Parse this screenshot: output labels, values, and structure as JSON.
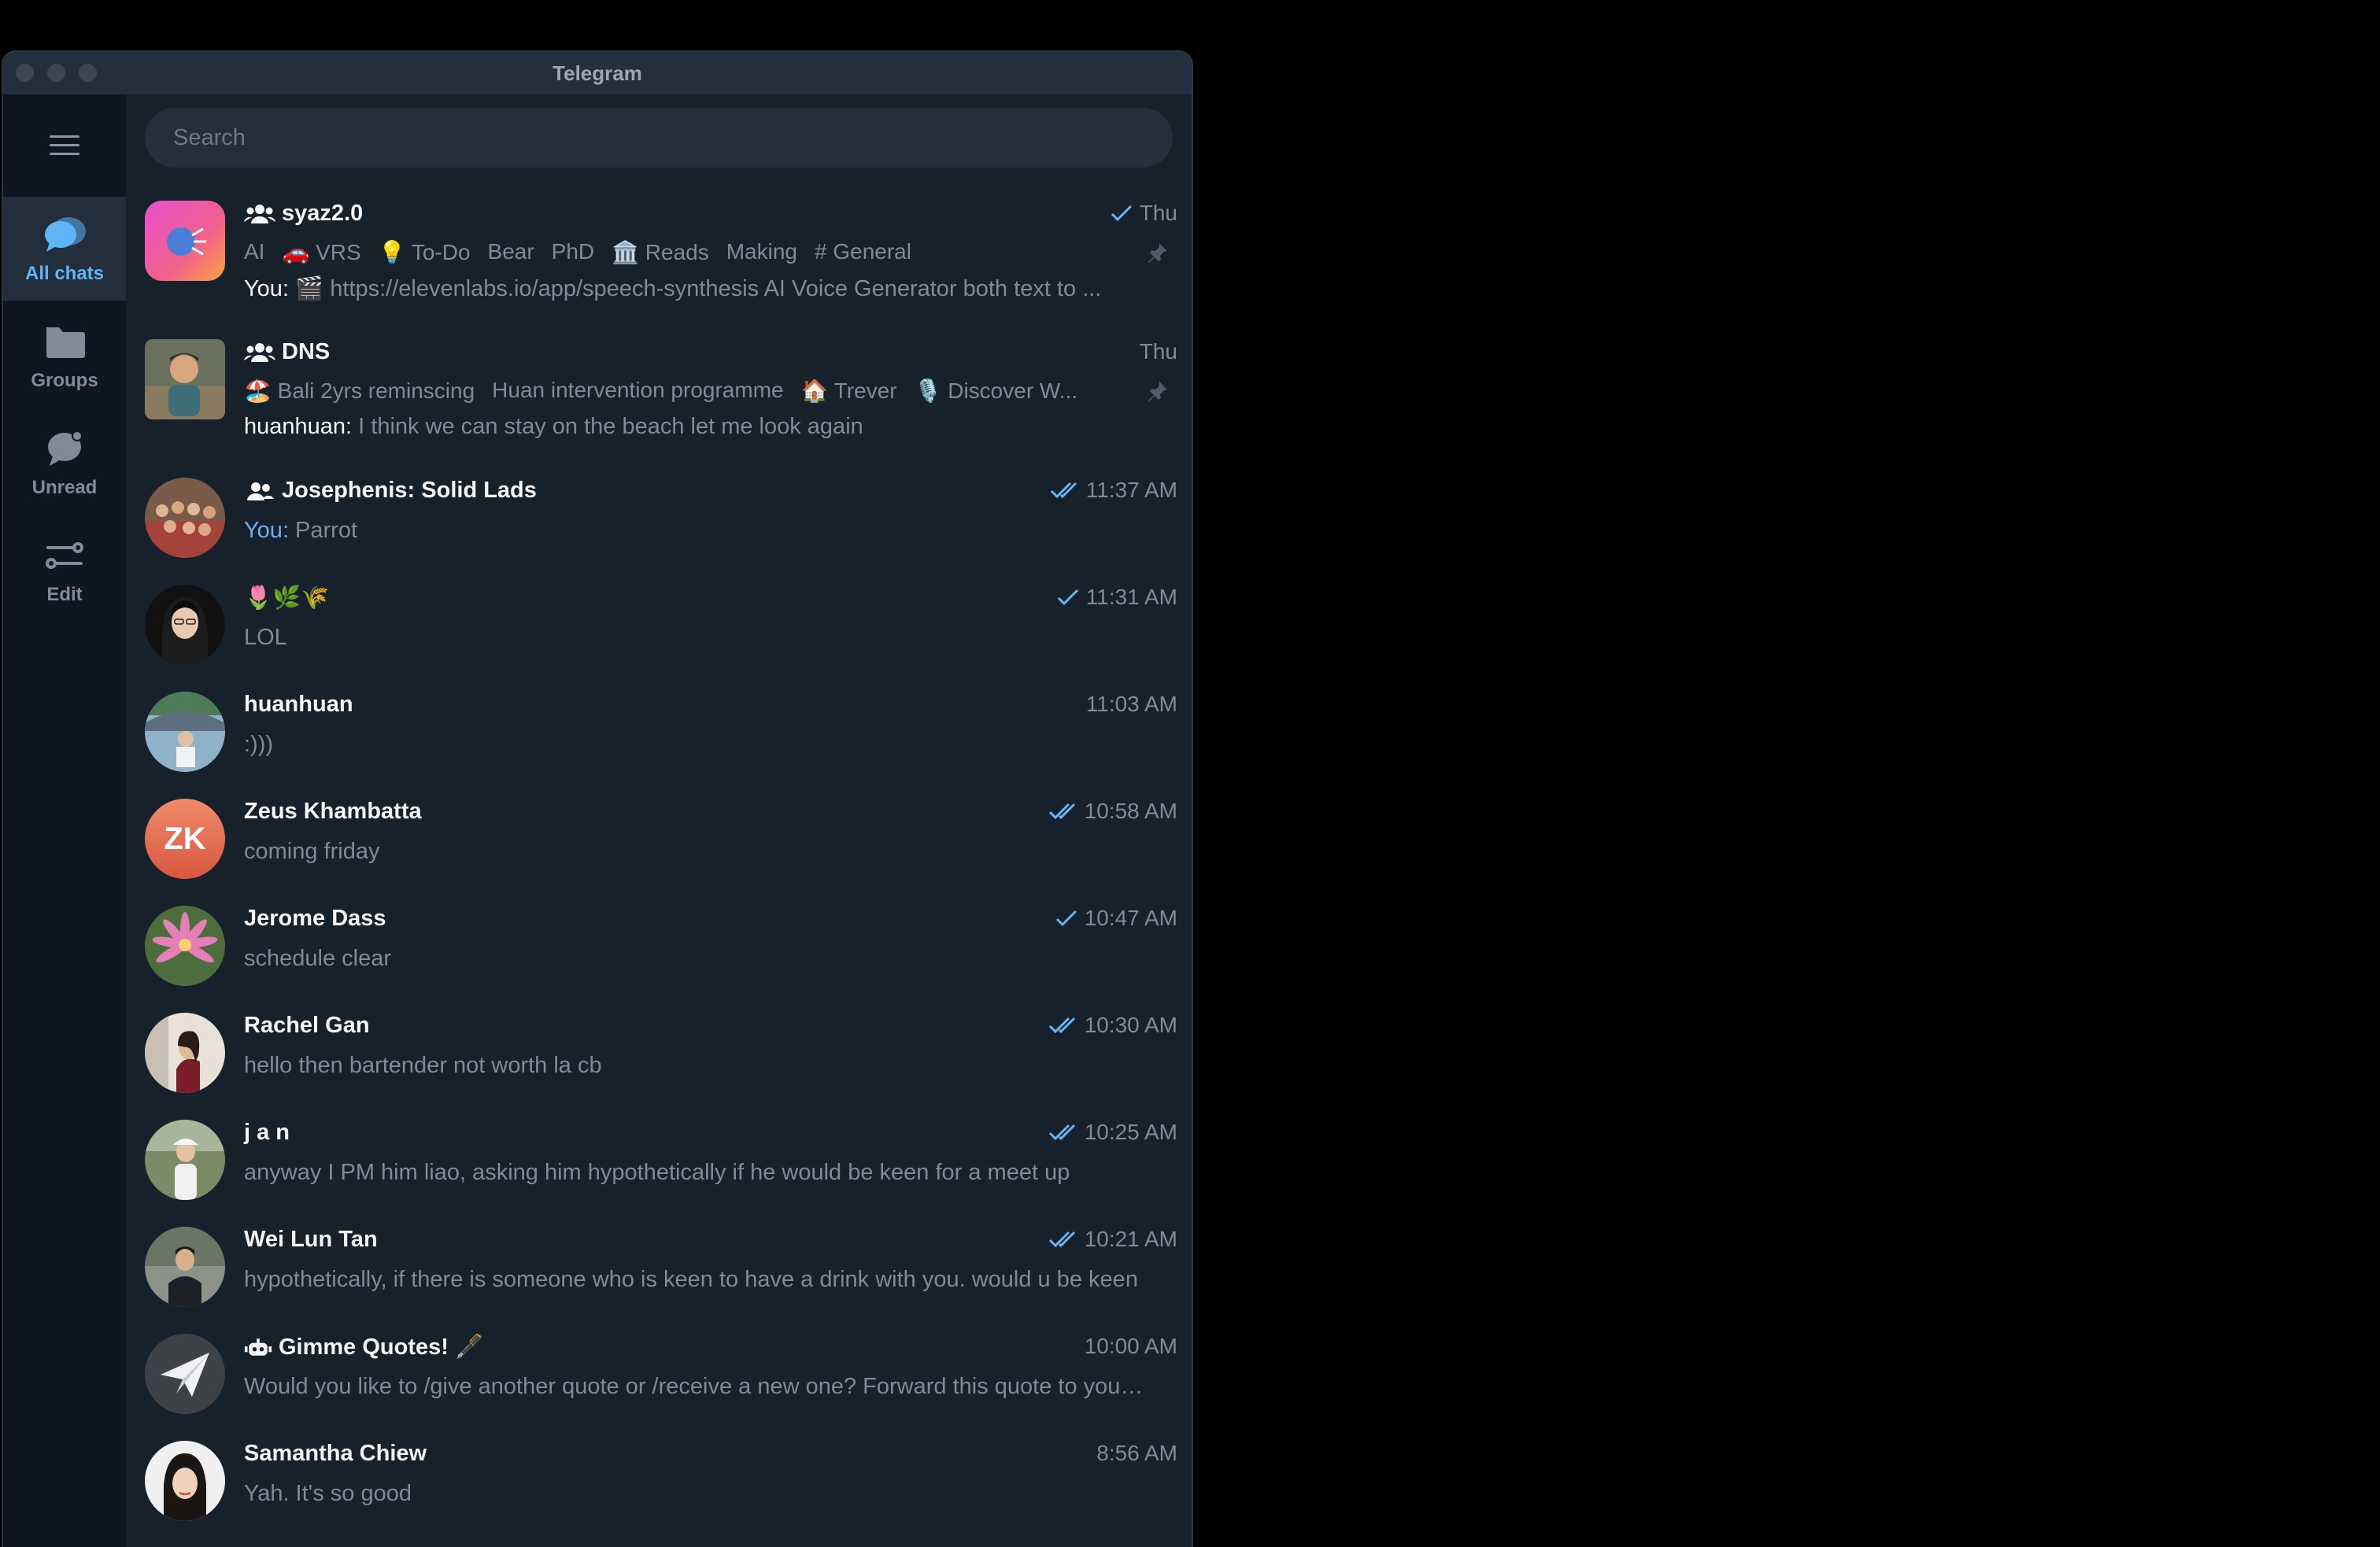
{
  "window": {
    "title": "Telegram"
  },
  "search": {
    "placeholder": "Search"
  },
  "colors": {
    "accent": "#5eb5f7",
    "background": "#17212b",
    "sidebar": "#0e1621",
    "read_check": "#6ab3f3"
  },
  "sidebar": {
    "items": [
      {
        "label": "All chats",
        "icon": "chats-icon",
        "active": true
      },
      {
        "label": "Groups",
        "icon": "folder-icon",
        "active": false
      },
      {
        "label": "Unread",
        "icon": "unread-icon",
        "active": false
      },
      {
        "label": "Edit",
        "icon": "sliders-icon",
        "active": false
      }
    ]
  },
  "chats": [
    {
      "name": "syaz2.0",
      "group": true,
      "time": "Thu",
      "status": "sent",
      "pinned": true,
      "tags": [
        "AI",
        "🚗 VRS",
        "💡 To-Do",
        "Bear",
        "PhD",
        "🏛️ Reads",
        "Making",
        "# General"
      ],
      "sender": "You:",
      "preview": "🎬 https://elevenlabs.io/app/speech-synthesis  AI Voice Generator both text to ..."
    },
    {
      "name": "DNS",
      "group": true,
      "time": "Thu",
      "status": "",
      "pinned": true,
      "tags": [
        "🏖️ Bali 2yrs reminscing",
        "Huan intervention programme",
        "🏠 Trever",
        "🎙️ Discover W..."
      ],
      "sender": "huanhuan:",
      "preview": " I think we can stay on the beach let me look again"
    },
    {
      "name": "Josephenis: Solid Lads",
      "group": true,
      "time": "11:37 AM",
      "status": "read",
      "sender": "You:",
      "preview": " Parrot"
    },
    {
      "name": "🌷🌿🌾",
      "group": false,
      "time": "11:31 AM",
      "status": "sent",
      "sender": "",
      "preview": "LOL"
    },
    {
      "name": "huanhuan",
      "group": false,
      "time": "11:03 AM",
      "status": "",
      "sender": "",
      "preview": ":)))"
    },
    {
      "name": "Zeus Khambatta",
      "group": false,
      "time": "10:58 AM",
      "status": "read",
      "sender": "",
      "preview": "coming friday",
      "initials": "ZK"
    },
    {
      "name": "Jerome Dass",
      "group": false,
      "time": "10:47 AM",
      "status": "sent",
      "sender": "",
      "preview": "schedule clear"
    },
    {
      "name": "Rachel Gan",
      "group": false,
      "time": "10:30 AM",
      "status": "read",
      "sender": "",
      "preview": "hello then bartender not worth la cb"
    },
    {
      "name": "j a n",
      "group": false,
      "time": "10:25 AM",
      "status": "read",
      "sender": "",
      "preview": "anyway I PM him liao, asking him hypothetically if he would be keen for a meet up"
    },
    {
      "name": "Wei Lun Tan",
      "group": false,
      "time": "10:21 AM",
      "status": "read",
      "sender": "",
      "preview": "hypothetically, if there is someone who is keen to have a drink with you. would u be keen"
    },
    {
      "name": "Gimme Quotes! 🖋️",
      "group": false,
      "bot": true,
      "time": "10:00 AM",
      "status": "",
      "sender": "",
      "preview": "Would you like to /give another quote or /receive a new one? Forward this quote to your ..."
    },
    {
      "name": "Samantha Chiew",
      "group": false,
      "time": "8:56 AM",
      "status": "",
      "sender": "",
      "preview": "Yah. It's so good"
    }
  ]
}
